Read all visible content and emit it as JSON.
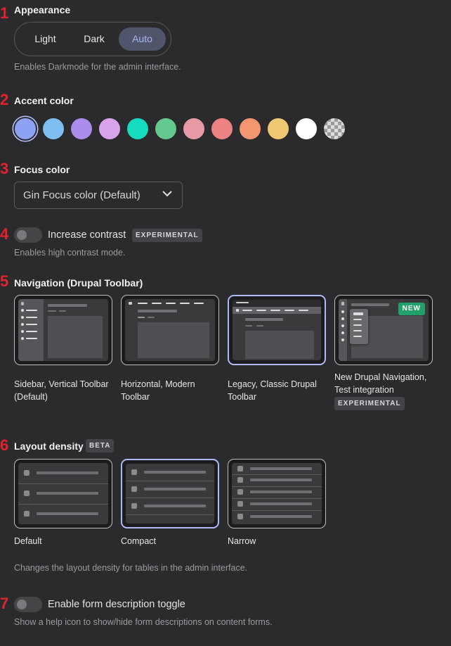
{
  "markers": [
    "1",
    "2",
    "3",
    "4",
    "5",
    "6",
    "7"
  ],
  "appearance": {
    "title": "Appearance",
    "options": [
      "Light",
      "Dark",
      "Auto"
    ],
    "selected": "Auto",
    "description": "Enables Darkmode for the admin interface."
  },
  "accent": {
    "title": "Accent color",
    "swatches": [
      "#8ea2f4",
      "#7fbef0",
      "#a98ceb",
      "#d9a4ec",
      "#16dbc1",
      "#65c98f",
      "#e79aa6",
      "#ec8282",
      "#f49770",
      "#f0c872",
      "#ffffff",
      "transparent-checker"
    ],
    "selected_index": 0
  },
  "focus": {
    "title": "Focus color",
    "value": "Gin Focus color (Default)"
  },
  "contrast": {
    "label": "Increase contrast",
    "badge": "EXPERIMENTAL",
    "description": "Enables high contrast mode.",
    "enabled": false
  },
  "navigation": {
    "title": "Navigation (Drupal Toolbar)",
    "options": [
      {
        "line1": "Sidebar, Vertical Toolbar",
        "line2": "(Default)"
      },
      {
        "line1": "Horizontal, Modern",
        "line2": "Toolbar"
      },
      {
        "line1": "Legacy, Classic Drupal",
        "line2": "Toolbar"
      },
      {
        "line1": "New Drupal Navigation,",
        "line2": "Test integration",
        "badge": "EXPERIMENTAL",
        "card_badge": "NEW"
      }
    ],
    "selected_index": 2
  },
  "density": {
    "title": "Layout density",
    "badge": "BETA",
    "options": [
      "Default",
      "Compact",
      "Narrow"
    ],
    "selected_index": 1,
    "description": "Changes the layout density for tables in the admin interface."
  },
  "formdesc": {
    "label": "Enable form description toggle",
    "description": "Show a help icon to show/hide form descriptions on content forms.",
    "enabled": false
  }
}
